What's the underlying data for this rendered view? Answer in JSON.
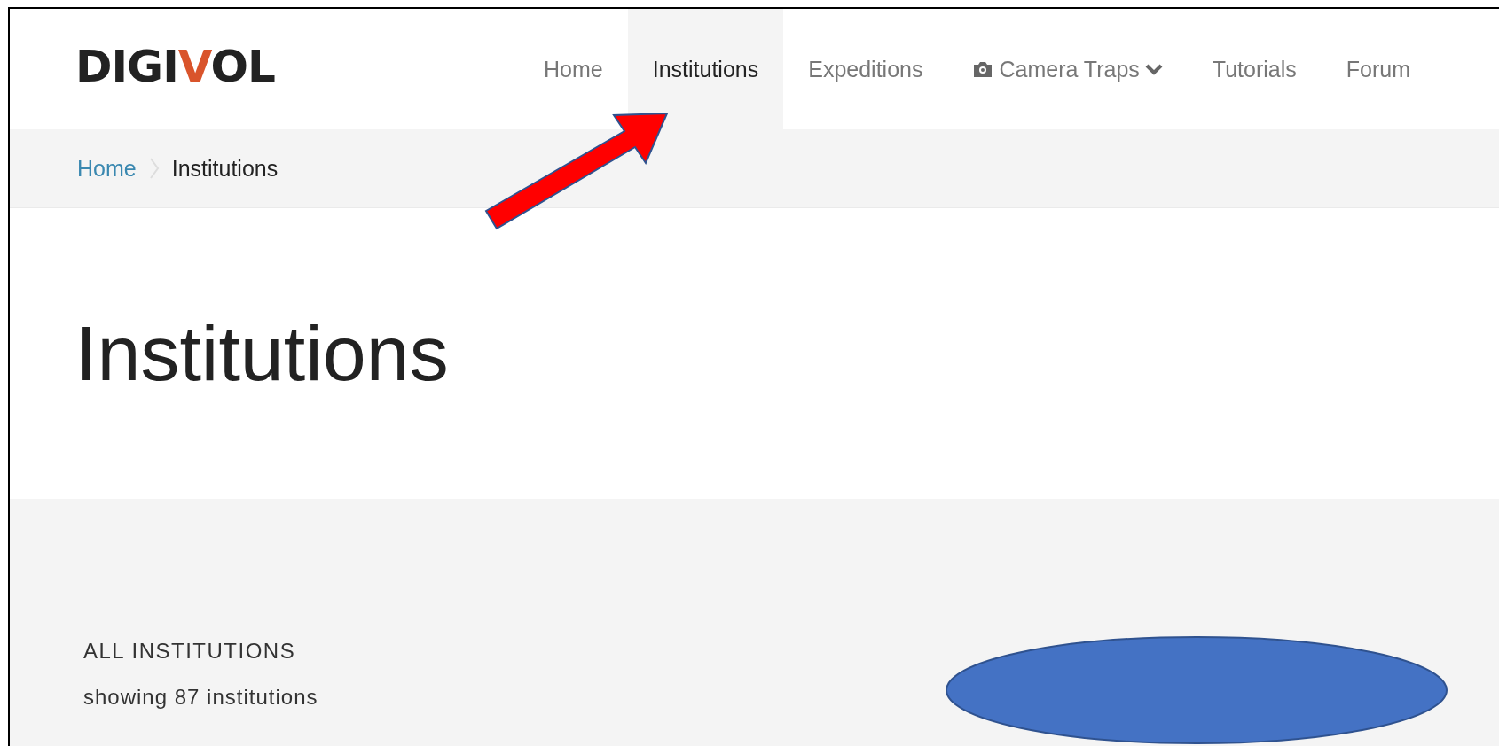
{
  "logo": {
    "before": "DIGI",
    "mark": "V",
    "after": "OL"
  },
  "nav": [
    {
      "label": "Home",
      "selected": false,
      "kind": "link"
    },
    {
      "label": "Institutions",
      "selected": true,
      "kind": "link"
    },
    {
      "label": "Expeditions",
      "selected": false,
      "kind": "link"
    },
    {
      "label": "Camera Traps",
      "selected": false,
      "kind": "dropdown"
    },
    {
      "label": "Tutorials",
      "selected": false,
      "kind": "link"
    },
    {
      "label": "Forum",
      "selected": false,
      "kind": "link"
    }
  ],
  "breadcrumb": [
    "Home",
    "Institutions"
  ],
  "page_title": "Institutions",
  "section": {
    "heading": "ALL INSTITUTIONS",
    "count": "showing 87 institutions"
  }
}
